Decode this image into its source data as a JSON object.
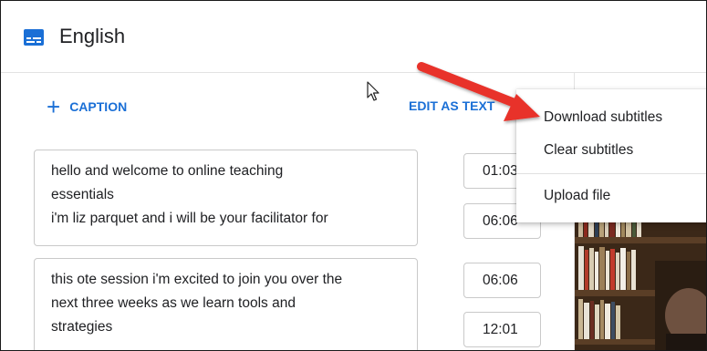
{
  "header": {
    "title": "English",
    "icon": "subtitles-icon",
    "accent": "#1a6fd6"
  },
  "toolbar": {
    "caption_plus": "+",
    "caption_label": "CAPTION",
    "edit_as_text_label": "EDIT AS TEXT"
  },
  "segments": [
    {
      "lines": [
        "hello and welcome to online teaching",
        "essentials",
        "i'm liz parquet and i will be your facilitator for"
      ],
      "start": "01:03",
      "end": "06:06"
    },
    {
      "lines": [
        "this ote session i'm excited to join you over the",
        "next three weeks as we learn tools and",
        "strategies"
      ],
      "start": "06:06",
      "end": "12:01"
    }
  ],
  "menu": {
    "items": [
      "Download subtitles",
      "Clear subtitles",
      "Upload file"
    ]
  },
  "annotation": {
    "arrow_color": "#e8322a"
  }
}
